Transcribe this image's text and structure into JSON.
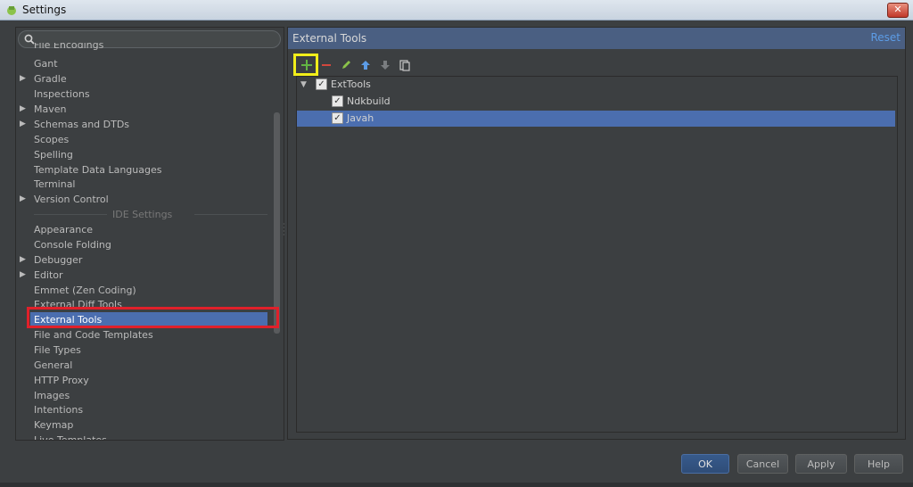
{
  "window": {
    "title": "Settings",
    "close_label": "✕"
  },
  "sidebar": {
    "items": [
      {
        "label": "File Encodings",
        "arrow": ""
      },
      {
        "label": "Gant",
        "arrow": ""
      },
      {
        "label": "Gradle",
        "arrow": "▶"
      },
      {
        "label": "Inspections",
        "arrow": ""
      },
      {
        "label": "Maven",
        "arrow": "▶"
      },
      {
        "label": "Schemas and DTDs",
        "arrow": "▶"
      },
      {
        "label": "Scopes",
        "arrow": ""
      },
      {
        "label": "Spelling",
        "arrow": ""
      },
      {
        "label": "Template Data Languages",
        "arrow": ""
      },
      {
        "label": "Terminal",
        "arrow": ""
      },
      {
        "label": "Version Control",
        "arrow": "▶"
      }
    ],
    "section_label": "IDE Settings",
    "ide_items": [
      {
        "label": "Appearance",
        "arrow": ""
      },
      {
        "label": "Console Folding",
        "arrow": ""
      },
      {
        "label": "Debugger",
        "arrow": "▶"
      },
      {
        "label": "Editor",
        "arrow": "▶"
      },
      {
        "label": "Emmet (Zen Coding)",
        "arrow": ""
      },
      {
        "label": "External Diff Tools",
        "arrow": ""
      },
      {
        "label": "External Tools",
        "arrow": "",
        "selected": true
      },
      {
        "label": "File and Code Templates",
        "arrow": ""
      },
      {
        "label": "File Types",
        "arrow": ""
      },
      {
        "label": "General",
        "arrow": ""
      },
      {
        "label": "HTTP Proxy",
        "arrow": ""
      },
      {
        "label": "Images",
        "arrow": ""
      },
      {
        "label": "Intentions",
        "arrow": ""
      },
      {
        "label": "Keymap",
        "arrow": ""
      },
      {
        "label": "Live Templates",
        "arrow": ""
      }
    ]
  },
  "panel": {
    "title": "External Tools",
    "reset_label": "Reset",
    "toolbar": {
      "add_icon": "plus-icon",
      "remove_icon": "minus-icon",
      "edit_icon": "pencil-icon",
      "up_icon": "arrow-up-icon",
      "down_icon": "arrow-down-icon",
      "copy_icon": "copy-icon"
    },
    "tree": {
      "group": {
        "label": "ExtTools",
        "checked": true
      },
      "tools": [
        {
          "label": "Ndkbuild",
          "checked": true,
          "selected": false
        },
        {
          "label": "Javah",
          "checked": true,
          "selected": true
        }
      ]
    }
  },
  "buttons": {
    "ok": "OK",
    "cancel": "Cancel",
    "apply": "Apply",
    "help": "Help"
  },
  "colors": {
    "background": "#3c3f41",
    "selection": "#4b6eaf",
    "header": "#4a5f82",
    "link": "#5c9ce6",
    "annotation_red": "#e0202a",
    "annotation_yellow": "#f2ee1a"
  }
}
